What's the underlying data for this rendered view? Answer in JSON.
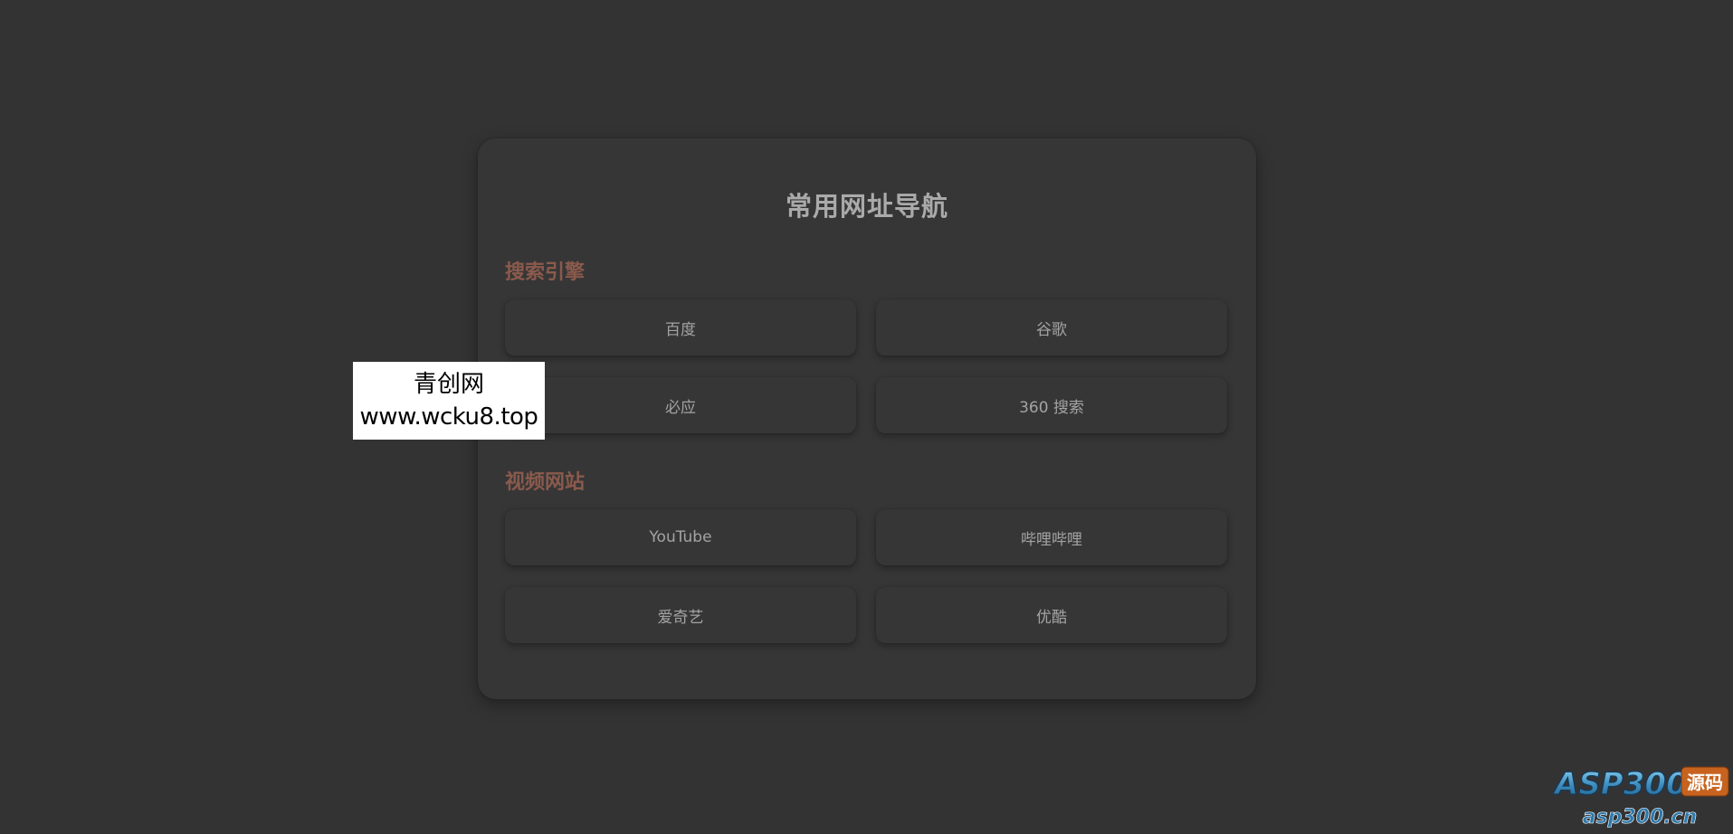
{
  "nav": {
    "title": "常用网址导航",
    "sections": [
      {
        "title": "搜索引擎",
        "links": [
          "百度",
          "谷歌",
          "必应",
          "360 搜索"
        ]
      },
      {
        "title": "视频网站",
        "links": [
          "YouTube",
          "哔哩哔哩",
          "爱奇艺",
          "优酷"
        ]
      }
    ]
  },
  "watermark": {
    "line1": "青创网",
    "line2": "www.wcku8.top"
  },
  "corner_logo": {
    "brand": "ASP300",
    "tag": "源码",
    "domain": "asp300.cn"
  },
  "colors": {
    "background": "#343334",
    "card": "#373637",
    "title_text": "#aaaaaa",
    "section_title": "#8a5a4c",
    "link_text": "#a3a3a3"
  }
}
